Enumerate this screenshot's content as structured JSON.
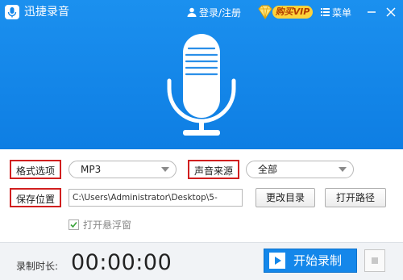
{
  "app": {
    "title": "迅捷录音"
  },
  "header": {
    "login_label": "登录/注册",
    "vip_label": "购买VIP",
    "menu_label": "菜单"
  },
  "settings": {
    "format": {
      "label": "格式选项",
      "value": "MP3"
    },
    "source": {
      "label": "声音来源",
      "value": "全部"
    },
    "save": {
      "label": "保存位置",
      "path": "C:\\Users\\Administrator\\Desktop\\5-",
      "change_dir_label": "更改目录",
      "open_path_label": "打开路径"
    },
    "float_window_label": "打开悬浮窗",
    "float_window_checked": true
  },
  "footer": {
    "duration_label": "录制时长:",
    "timer": "00:00:00",
    "record_label": "开始录制"
  },
  "colors": {
    "header_blue": "#1487ea",
    "highlight_red": "#d11f1f"
  }
}
